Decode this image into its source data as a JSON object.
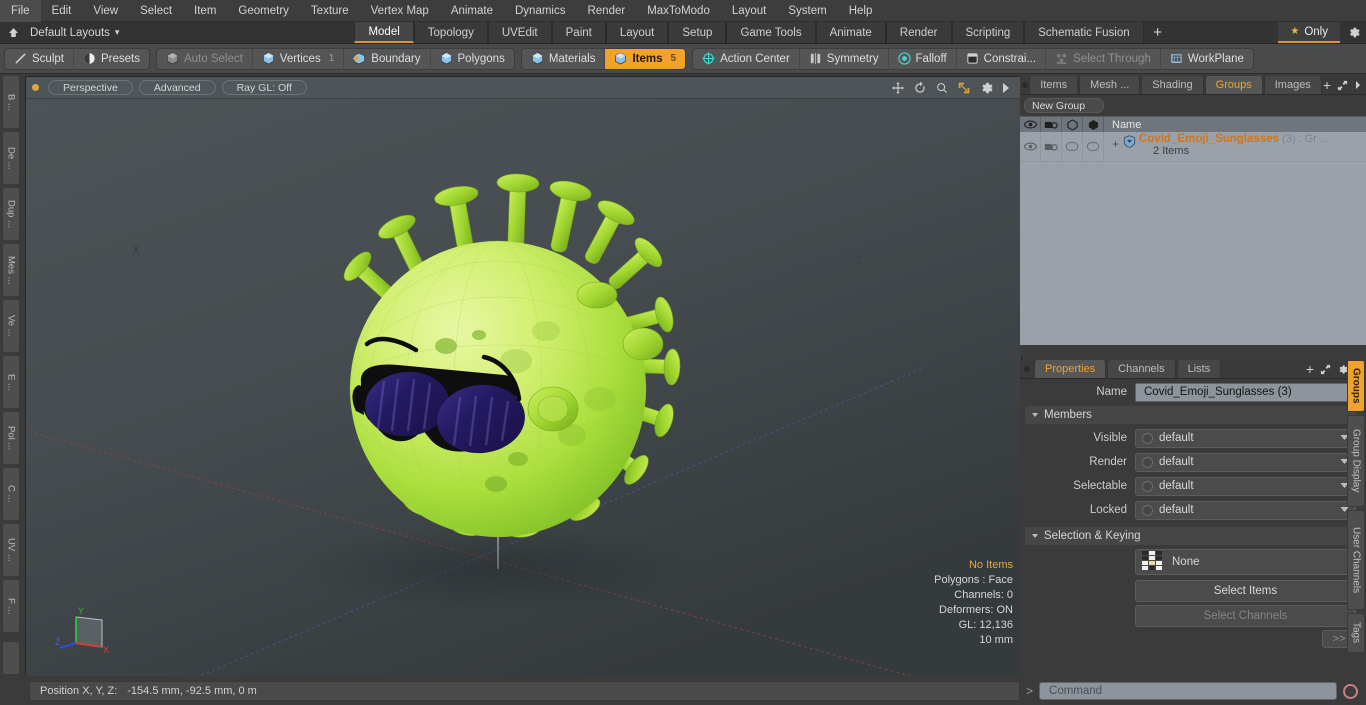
{
  "menu": {
    "items": [
      "File",
      "Edit",
      "View",
      "Select",
      "Item",
      "Geometry",
      "Texture",
      "Vertex Map",
      "Animate",
      "Dynamics",
      "Render",
      "MaxToModo",
      "Layout",
      "System",
      "Help"
    ]
  },
  "layoutbar": {
    "home_icon": "home-icon",
    "layouts_label": "Default Layouts",
    "chevron": "▾",
    "tabs": [
      {
        "label": "Model",
        "active": true
      },
      {
        "label": "Topology",
        "active": false
      },
      {
        "label": "UVEdit",
        "active": false
      },
      {
        "label": "Paint",
        "active": false
      },
      {
        "label": "Layout",
        "active": false
      },
      {
        "label": "Setup",
        "active": false
      },
      {
        "label": "Game Tools",
        "active": false
      },
      {
        "label": "Animate",
        "active": false
      },
      {
        "label": "Render",
        "active": false
      },
      {
        "label": "Scripting",
        "active": false
      },
      {
        "label": "Schematic Fusion",
        "active": false
      }
    ],
    "plus_label": "+",
    "only_label": "Only",
    "only_star": "★",
    "gear_icon": "gear-icon"
  },
  "toolbar": {
    "groups": [
      {
        "buttons": [
          {
            "label": "Sculpt",
            "icon": "sculpt-icon",
            "state": "normal",
            "badge": ""
          },
          {
            "label": "Presets",
            "icon": "presets-icon",
            "state": "normal",
            "badge": ""
          }
        ]
      },
      {
        "buttons": [
          {
            "label": "Auto Select",
            "icon": "cube-gray-icon",
            "state": "dim",
            "badge": ""
          },
          {
            "label": "Vertices",
            "icon": "cube-blue-icon",
            "state": "normal",
            "badge": "1"
          },
          {
            "label": "Boundary",
            "icon": "boundary-icon",
            "state": "normal",
            "badge": ""
          },
          {
            "label": "Polygons",
            "icon": "cube-blue-icon",
            "state": "normal",
            "badge": ""
          }
        ]
      },
      {
        "buttons": [
          {
            "label": "Materials",
            "icon": "cube-blue-icon",
            "state": "normal",
            "badge": ""
          },
          {
            "label": "Items",
            "icon": "cube-blue-icon",
            "state": "selected",
            "badge": "5"
          }
        ]
      },
      {
        "buttons": [
          {
            "label": "Action Center",
            "icon": "action-center-icon",
            "state": "normal",
            "badge": ""
          },
          {
            "label": "Symmetry",
            "icon": "symmetry-icon",
            "state": "normal",
            "badge": ""
          },
          {
            "label": "Falloff",
            "icon": "falloff-icon",
            "state": "normal",
            "badge": ""
          },
          {
            "label": "Constrai...",
            "icon": "constraint-icon",
            "state": "normal",
            "badge": ""
          },
          {
            "label": "Select Through",
            "icon": "select-through-icon",
            "state": "dim",
            "badge": ""
          },
          {
            "label": "WorkPlane",
            "icon": "workplane-icon",
            "state": "normal",
            "badge": ""
          }
        ]
      }
    ]
  },
  "left_strip": {
    "tabs": [
      "B ...",
      "De ...",
      "Dup ...",
      "Mes ...",
      "Ve ...",
      "E ...",
      "Pol ...",
      "C ...",
      "UV ...",
      "F ..."
    ]
  },
  "viewport": {
    "projection": "Perspective",
    "shading": "Advanced",
    "raygl": "Ray GL: Off",
    "icons": [
      "pan-icon",
      "rotate-icon",
      "zoom-icon",
      "fit-icon",
      "gear-icon",
      "play-icon"
    ],
    "axis_label_x": "X",
    "stats": {
      "selection": "No Items",
      "polygons": "Polygons : Face",
      "channels": "Channels: 0",
      "deformers": "Deformers: ON",
      "gl": "GL: 12,136",
      "scale": "10 mm"
    },
    "gizmo": {
      "x": "X",
      "y": "Y",
      "z": "Z"
    }
  },
  "groups_panel": {
    "tabs": [
      {
        "label": "Items",
        "active": false
      },
      {
        "label": "Mesh ...",
        "active": false
      },
      {
        "label": "Shading",
        "active": false
      },
      {
        "label": "Groups",
        "active": true
      },
      {
        "label": "Images",
        "active": false
      }
    ],
    "plus_label": "+",
    "expand_icon": "expand-icon",
    "arrow_icon": "chevron-right-icon",
    "new_group_label": "New Group",
    "column_icons": [
      "eye-icon",
      "render-icon",
      "shade-icon",
      "wire-icon"
    ],
    "name_column": "Name",
    "rows": [
      {
        "expander": "+",
        "icon": "group-shield-icon",
        "name": "Covid_Emoji_Sunglasses",
        "count": "(3)",
        "meta": ": Gr ...",
        "sub": "2 Items"
      }
    ]
  },
  "properties_panel": {
    "tabs": [
      {
        "label": "Properties",
        "active": true
      },
      {
        "label": "Channels",
        "active": false
      },
      {
        "label": "Lists",
        "active": false
      }
    ],
    "plus_label": "+",
    "expand_icon": "expand-icon",
    "gear_icon": "gear-icon",
    "arrow_icon": "chevron-right-icon",
    "name_label": "Name",
    "name_value": "Covid_Emoji_Sunglasses (3)",
    "members_section": "Members",
    "fields": [
      {
        "label": "Visible",
        "value": "default"
      },
      {
        "label": "Render",
        "value": "default"
      },
      {
        "label": "Selectable",
        "value": "default"
      },
      {
        "label": "Locked",
        "value": "default"
      }
    ],
    "selection_section": "Selection & Keying",
    "selection_set": "None",
    "select_items_label": "Select Items",
    "select_channels_label": "Select Channels",
    "more_label": ">>"
  },
  "right_strip": {
    "tabs": [
      {
        "label": "Groups",
        "active": true
      },
      {
        "label": "Group Display",
        "active": false
      },
      {
        "label": "User Channels",
        "active": false
      },
      {
        "label": "Tags",
        "active": false
      }
    ]
  },
  "statusbar": {
    "position_label": "Position X, Y, Z:",
    "position_value": "-154.5 mm, -92.5 mm, 0 m"
  },
  "command": {
    "caret": ">",
    "placeholder": "Command",
    "record_icon": "record-icon"
  },
  "colors": {
    "accent": "#f0a32c",
    "group_name": "#d0761a",
    "virus_body": "#b9e84a",
    "virus_light": "#d9f07e",
    "glasses": "#111111",
    "lens": "#2b2070"
  }
}
